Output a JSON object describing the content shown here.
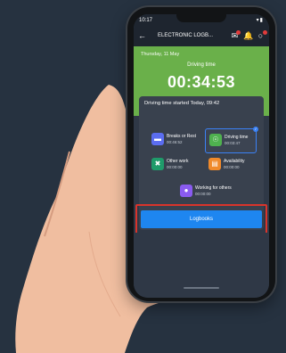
{
  "status_bar": {
    "time": "10:17",
    "signal": "▾▮"
  },
  "app_bar": {
    "title": "ELECTRONIC LOGB..."
  },
  "summary": {
    "date": "Thursday, 11 May",
    "label": "Driving time",
    "timer": "00:34:53"
  },
  "card": {
    "header": "Driving time started Today, 09:42",
    "tiles": [
      {
        "title": "Breaks or Rest",
        "value": "00:46:52",
        "icon": "bed-icon"
      },
      {
        "title": "Driving time",
        "value": "00:03:47",
        "icon": "steering-wheel-icon",
        "selected": true
      },
      {
        "title": "Other work",
        "value": "00:00:00",
        "icon": "tools-icon"
      },
      {
        "title": "Availability",
        "value": "00:00:00",
        "icon": "availability-icon"
      },
      {
        "title": "Working for others",
        "value": "00:00:00",
        "icon": "user-icon"
      }
    ]
  },
  "logbooks_button": "Logbooks",
  "colors": {
    "accent": "#1e86f0",
    "green": "#6ab04a",
    "highlight": "#d9342b"
  }
}
